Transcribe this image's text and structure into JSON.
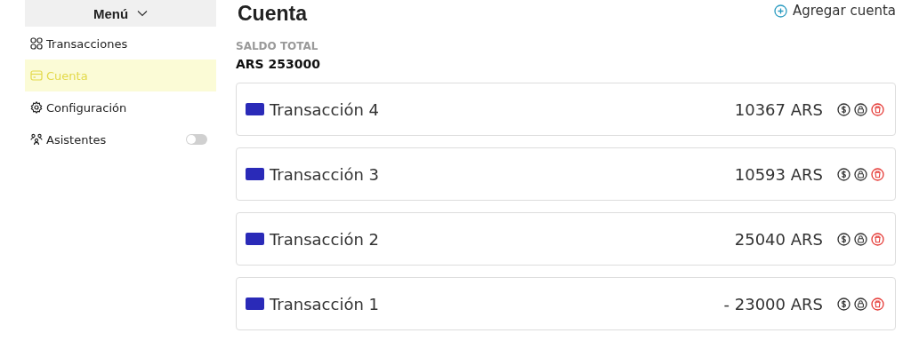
{
  "sidebar": {
    "header": "Menú",
    "items": [
      {
        "label": "Transacciones",
        "selected": false,
        "kind": "link"
      },
      {
        "label": "Cuenta",
        "selected": true,
        "kind": "link"
      },
      {
        "label": "Configuración",
        "selected": false,
        "kind": "link"
      },
      {
        "label": "Asistentes",
        "selected": false,
        "kind": "toggle",
        "on": false
      }
    ]
  },
  "main": {
    "title": "Cuenta",
    "add_button": "Agregar cuenta",
    "balance_label": "SALDO TOTAL",
    "balance": "ARS 253000",
    "transactions": [
      {
        "name": "Transacción 4",
        "amount": "10367 ARS"
      },
      {
        "name": "Transacción 3",
        "amount": "10593 ARS"
      },
      {
        "name": "Transacción 2",
        "amount": "25040 ARS"
      },
      {
        "name": "Transacción 1",
        "amount": "- 23000 ARS"
      }
    ]
  }
}
